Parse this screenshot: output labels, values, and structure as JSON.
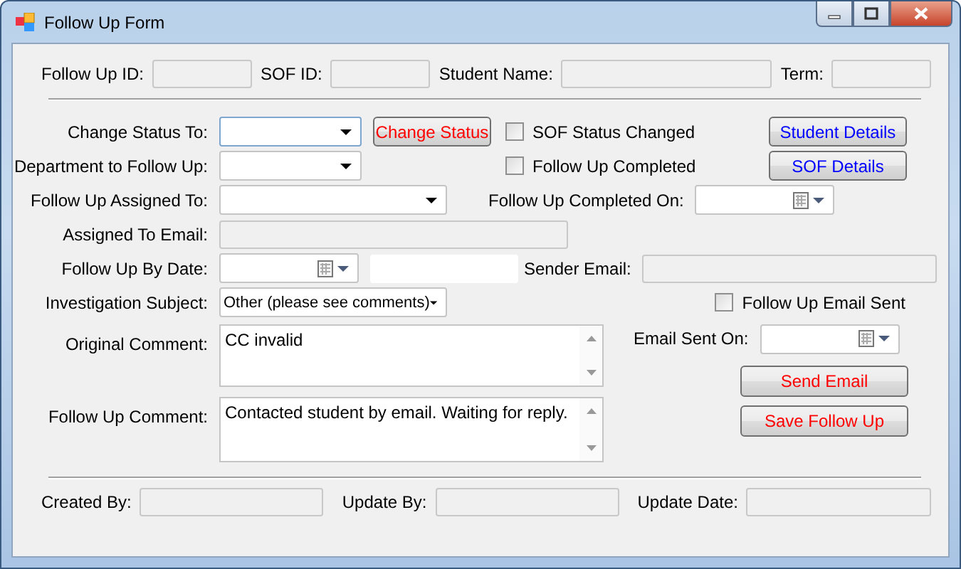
{
  "window": {
    "title": "Follow Up Form"
  },
  "header_fields": [
    {
      "label": "Follow Up ID:"
    },
    {
      "label": "SOF ID:"
    },
    {
      "label": "Student Name:"
    },
    {
      "label": "Term:"
    }
  ],
  "change_status": {
    "label": "Change Status To:"
  },
  "department": {
    "label": "Department to Follow Up:"
  },
  "assigned_to": {
    "label": "Follow Up Assigned To:"
  },
  "assigned_email": {
    "label": "Assigned To Email:"
  },
  "follow_up_by_date": {
    "label": "Follow Up By Date:"
  },
  "sender_email": {
    "label": "Sender Email:"
  },
  "investigation_subject": {
    "label": "Investigation Subject:",
    "value": "Other (please see comments)"
  },
  "original_comment": {
    "label": "Original Comment:",
    "value": "CC invalid"
  },
  "follow_up_comment": {
    "label": "Follow Up Comment:",
    "value": "Contacted student by email. Waiting for reply."
  },
  "completed_on": {
    "label": "Follow Up Completed On:"
  },
  "email_sent_on": {
    "label": "Email Sent On:"
  },
  "checkboxes": [
    {
      "label": "SOF Status Changed",
      "checked": false
    },
    {
      "label": "Follow Up Completed",
      "checked": false
    },
    {
      "label": "Follow Up Email Sent",
      "checked": false
    }
  ],
  "buttons": [
    {
      "label": "Change Status",
      "color": "#ff0000"
    },
    {
      "label": "Student Details",
      "color": "#0000ff"
    },
    {
      "label": "SOF Details",
      "color": "#0000ff"
    },
    {
      "label": "Send Email",
      "color": "#ff0000"
    },
    {
      "label": "Save Follow Up",
      "color": "#ff0000"
    }
  ],
  "footer_fields": [
    {
      "label": "Created By:"
    },
    {
      "label": "Update By:"
    },
    {
      "label": "Update Date:"
    }
  ]
}
